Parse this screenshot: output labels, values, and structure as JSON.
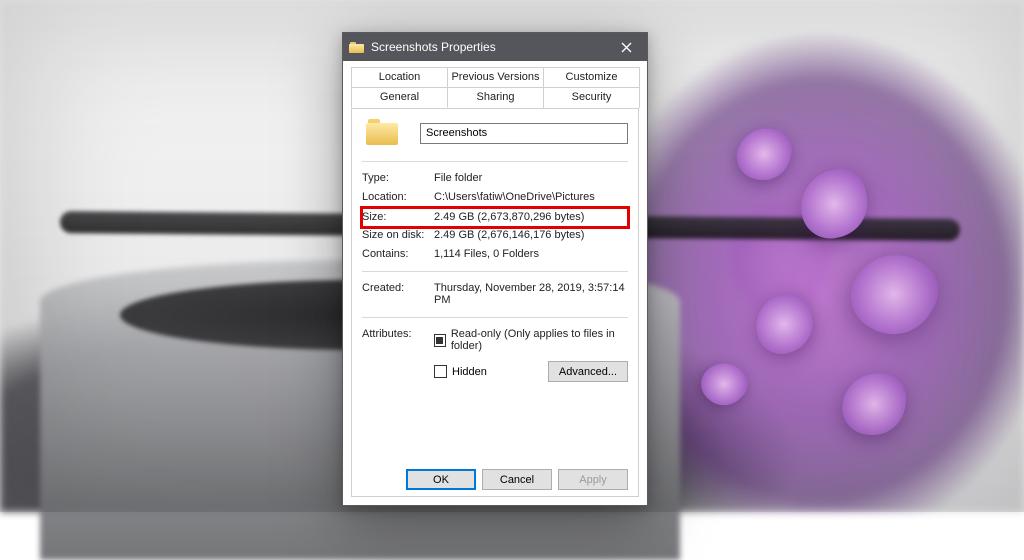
{
  "window": {
    "title": "Screenshots Properties"
  },
  "tabs": {
    "row1": [
      "Location",
      "Previous Versions",
      "Customize"
    ],
    "row2": [
      "General",
      "Sharing",
      "Security"
    ],
    "active": "General"
  },
  "general": {
    "name_value": "Screenshots",
    "type_label": "Type:",
    "type_value": "File folder",
    "location_label": "Location:",
    "location_value": "C:\\Users\\fatiw\\OneDrive\\Pictures",
    "size_label": "Size:",
    "size_value": "2.49 GB (2,673,870,296 bytes)",
    "size_on_disk_label": "Size on disk:",
    "size_on_disk_value": "2.49 GB (2,676,146,176 bytes)",
    "contains_label": "Contains:",
    "contains_value": "1,114 Files, 0 Folders",
    "created_label": "Created:",
    "created_value": "Thursday, November 28, 2019, 3:57:14 PM",
    "attributes_label": "Attributes:",
    "readonly_label": "Read-only (Only applies to files in folder)",
    "hidden_label": "Hidden",
    "advanced_label": "Advanced..."
  },
  "buttons": {
    "ok": "OK",
    "cancel": "Cancel",
    "apply": "Apply"
  }
}
